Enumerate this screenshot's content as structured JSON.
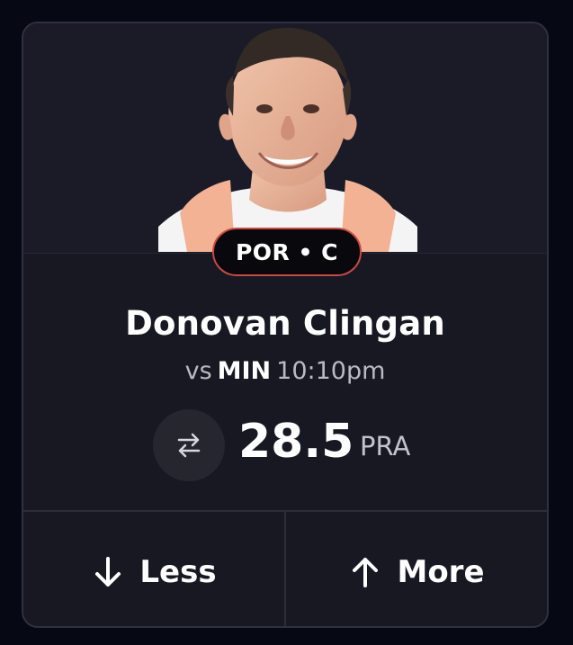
{
  "card": {
    "team_position": "POR • C",
    "player_name": "Donovan Clingan",
    "matchup": {
      "prefix": "vs",
      "opponent": "MIN",
      "time": "10:10pm"
    },
    "line": {
      "value": "28.5",
      "stat": "PRA"
    },
    "actions": {
      "less_label": "Less",
      "more_label": "More"
    }
  },
  "icons": {
    "swap": "swap-arrows-icon",
    "less": "arrow-down-icon",
    "more": "arrow-up-icon"
  },
  "colors": {
    "background": "#060913",
    "card": "#181823",
    "badge_border": "#c94a43",
    "text": "#ffffff",
    "muted_text": "#b9bac5"
  }
}
